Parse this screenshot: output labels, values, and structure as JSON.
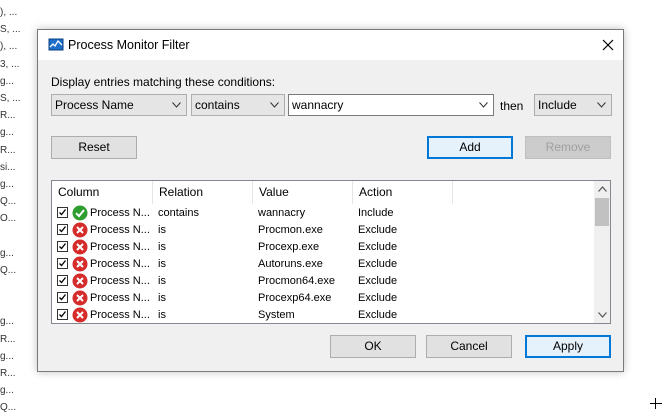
{
  "background_fragments": [
    "), ...",
    "S, ...",
    "), ...",
    "3, ...",
    "g...",
    "S, ...",
    "R...",
    "g...",
    "R...",
    "si...",
    "g...",
    "Q...",
    "O...",
    "",
    "g...",
    "Q...",
    "",
    "",
    "g...",
    "R...",
    "g...",
    "R...",
    "g...",
    "Q..."
  ],
  "dialog": {
    "title": "Process Monitor Filter",
    "close_glyph": "✕"
  },
  "conditions": {
    "label": "Display entries matching these conditions:",
    "column_value": "Process Name",
    "relation_value": "contains",
    "value_text": "wannacry",
    "then_label": "then",
    "action_value": "Include"
  },
  "buttons": {
    "reset": "Reset",
    "add": "Add",
    "remove": "Remove",
    "ok": "OK",
    "cancel": "Cancel",
    "apply": "Apply"
  },
  "list": {
    "headers": [
      "Column",
      "Relation",
      "Value",
      "Action"
    ],
    "rows": [
      {
        "column": "Process N...",
        "relation": "contains",
        "value": "wannacry",
        "action": "Include",
        "status": "include",
        "checked": true
      },
      {
        "column": "Process N...",
        "relation": "is",
        "value": "Procmon.exe",
        "action": "Exclude",
        "status": "exclude",
        "checked": true
      },
      {
        "column": "Process N...",
        "relation": "is",
        "value": "Procexp.exe",
        "action": "Exclude",
        "status": "exclude",
        "checked": true
      },
      {
        "column": "Process N...",
        "relation": "is",
        "value": "Autoruns.exe",
        "action": "Exclude",
        "status": "exclude",
        "checked": true
      },
      {
        "column": "Process N...",
        "relation": "is",
        "value": "Procmon64.exe",
        "action": "Exclude",
        "status": "exclude",
        "checked": true
      },
      {
        "column": "Process N...",
        "relation": "is",
        "value": "Procexp64.exe",
        "action": "Exclude",
        "status": "exclude",
        "checked": true
      },
      {
        "column": "Process N...",
        "relation": "is",
        "value": "System",
        "action": "Exclude",
        "status": "exclude",
        "checked": true
      }
    ]
  },
  "colors": {
    "include_icon": "#2e9e2e",
    "exclude_icon": "#d62b2b",
    "default_button_border": "#0078d7"
  }
}
